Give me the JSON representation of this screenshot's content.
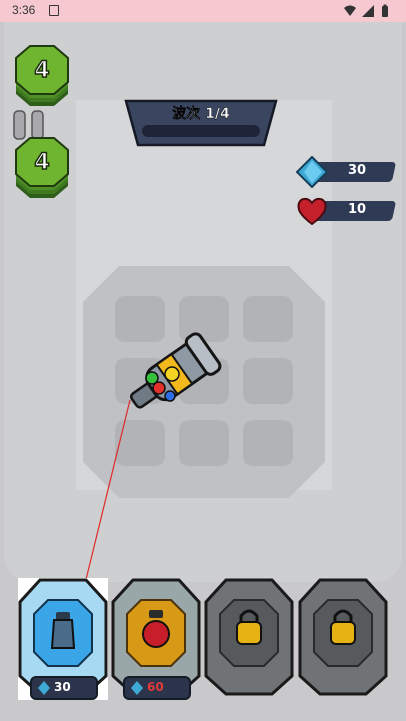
{
  "status_bar": {
    "time": "3:36"
  },
  "level_badges": [
    {
      "value": "4"
    },
    {
      "value": "4"
    }
  ],
  "wave": {
    "label": "波次 1/4",
    "progress": 0
  },
  "resources": {
    "gems": {
      "value": "30",
      "icon": "diamond-icon",
      "color": "#3fa9d6"
    },
    "lives": {
      "value": "10",
      "icon": "heart-icon",
      "color": "#c4202c"
    }
  },
  "cards": [
    {
      "name": "bomb-tower",
      "cost": "30",
      "state": "selected",
      "cost_color": "#ffffff"
    },
    {
      "name": "fire-tower",
      "cost": "60",
      "state": "available",
      "cost_color": "#e23b3b"
    },
    {
      "name": "locked",
      "state": "locked"
    },
    {
      "name": "locked",
      "state": "locked"
    }
  ]
}
